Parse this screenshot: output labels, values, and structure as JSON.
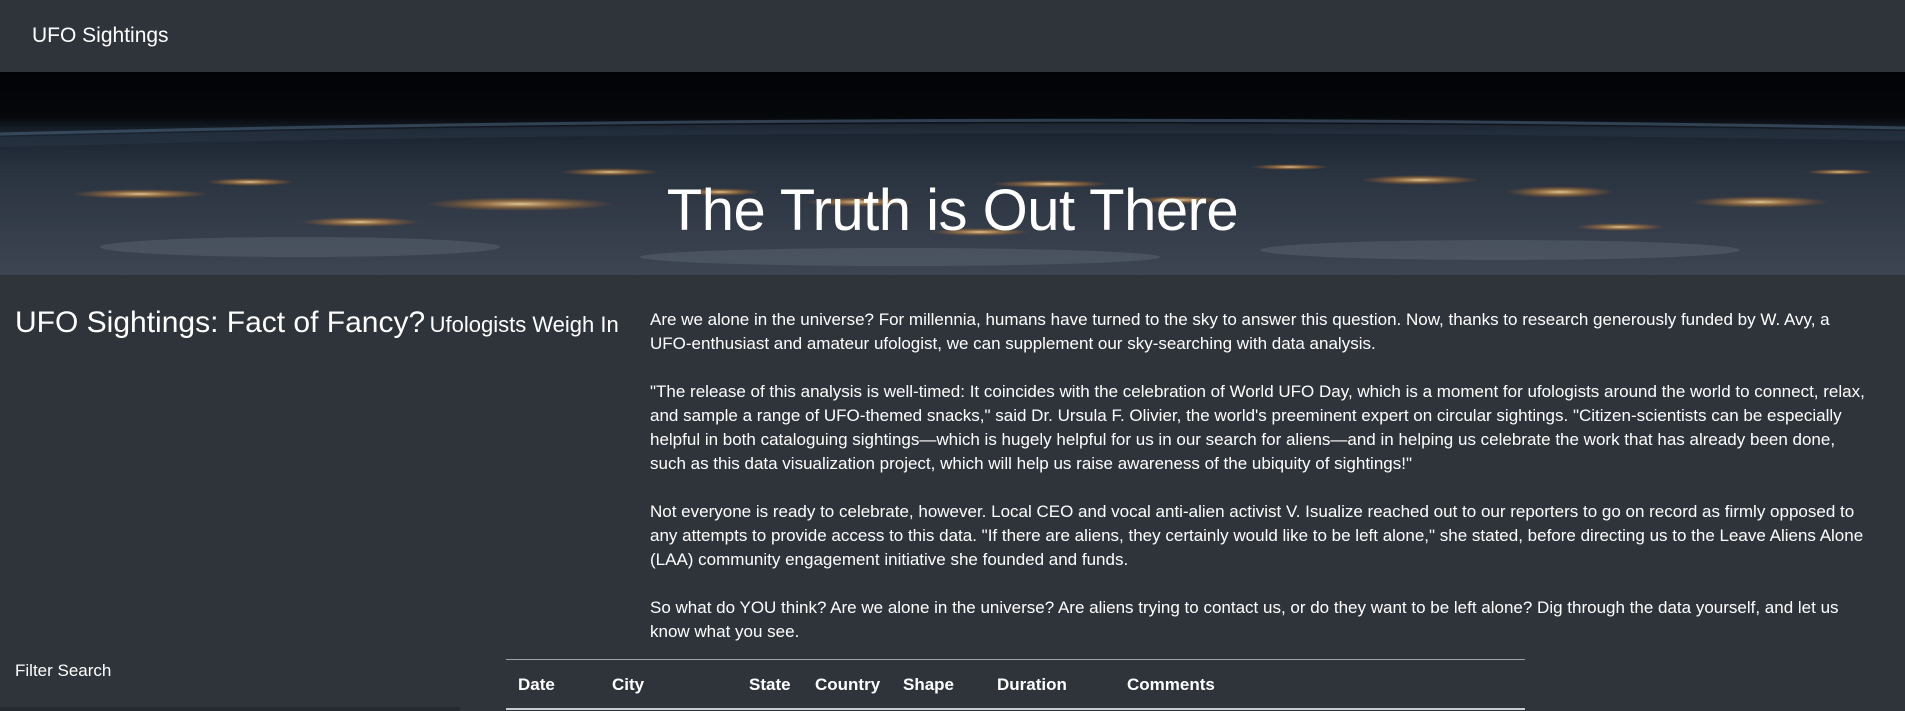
{
  "navbar": {
    "brand": "UFO Sightings"
  },
  "hero": {
    "title": "The Truth is Out There"
  },
  "heading": {
    "main": "UFO Sightings: Fact of Fancy?",
    "sub": "Ufologists Weigh In"
  },
  "article": {
    "paragraphs": [
      "Are we alone in the universe? For millennia, humans have turned to the sky to answer this question. Now, thanks to research generously funded by W. Avy, a UFO-enthusiast and amateur ufologist, we can supplement our sky-searching with data analysis.",
      "\"The release of this analysis is well-timed: It coincides with the celebration of World UFO Day, which is a moment for ufologists around the world to connect, relax, and sample a range of UFO-themed snacks,\" said Dr. Ursula F. Olivier, the world's preeminent expert on circular sightings. \"Citizen-scientists can be especially helpful in both cataloguing sightings—which is hugely helpful for us in our search for aliens—and in helping us celebrate the work that has already been done, such as this data visualization project, which will help us raise awareness of the ubiquity of sightings!\"",
      "Not everyone is ready to celebrate, however. Local CEO and vocal anti-alien activist V. Isualize reached out to our reporters to go on record as firmly opposed to any attempts to provide access to this data. \"If there are aliens, they certainly would like to be left alone,\" she stated, before directing us to the Leave Aliens Alone (LAA) community engagement initiative she founded and funds.",
      "So what do YOU think? Are we alone in the universe? Are aliens trying to contact us, or do they want to be left alone? Dig through the data yourself, and let us know what you see."
    ]
  },
  "filter": {
    "label": "Filter Search"
  },
  "table": {
    "headers": [
      "Date",
      "City",
      "State",
      "Country",
      "Shape",
      "Duration",
      "Comments"
    ]
  }
}
